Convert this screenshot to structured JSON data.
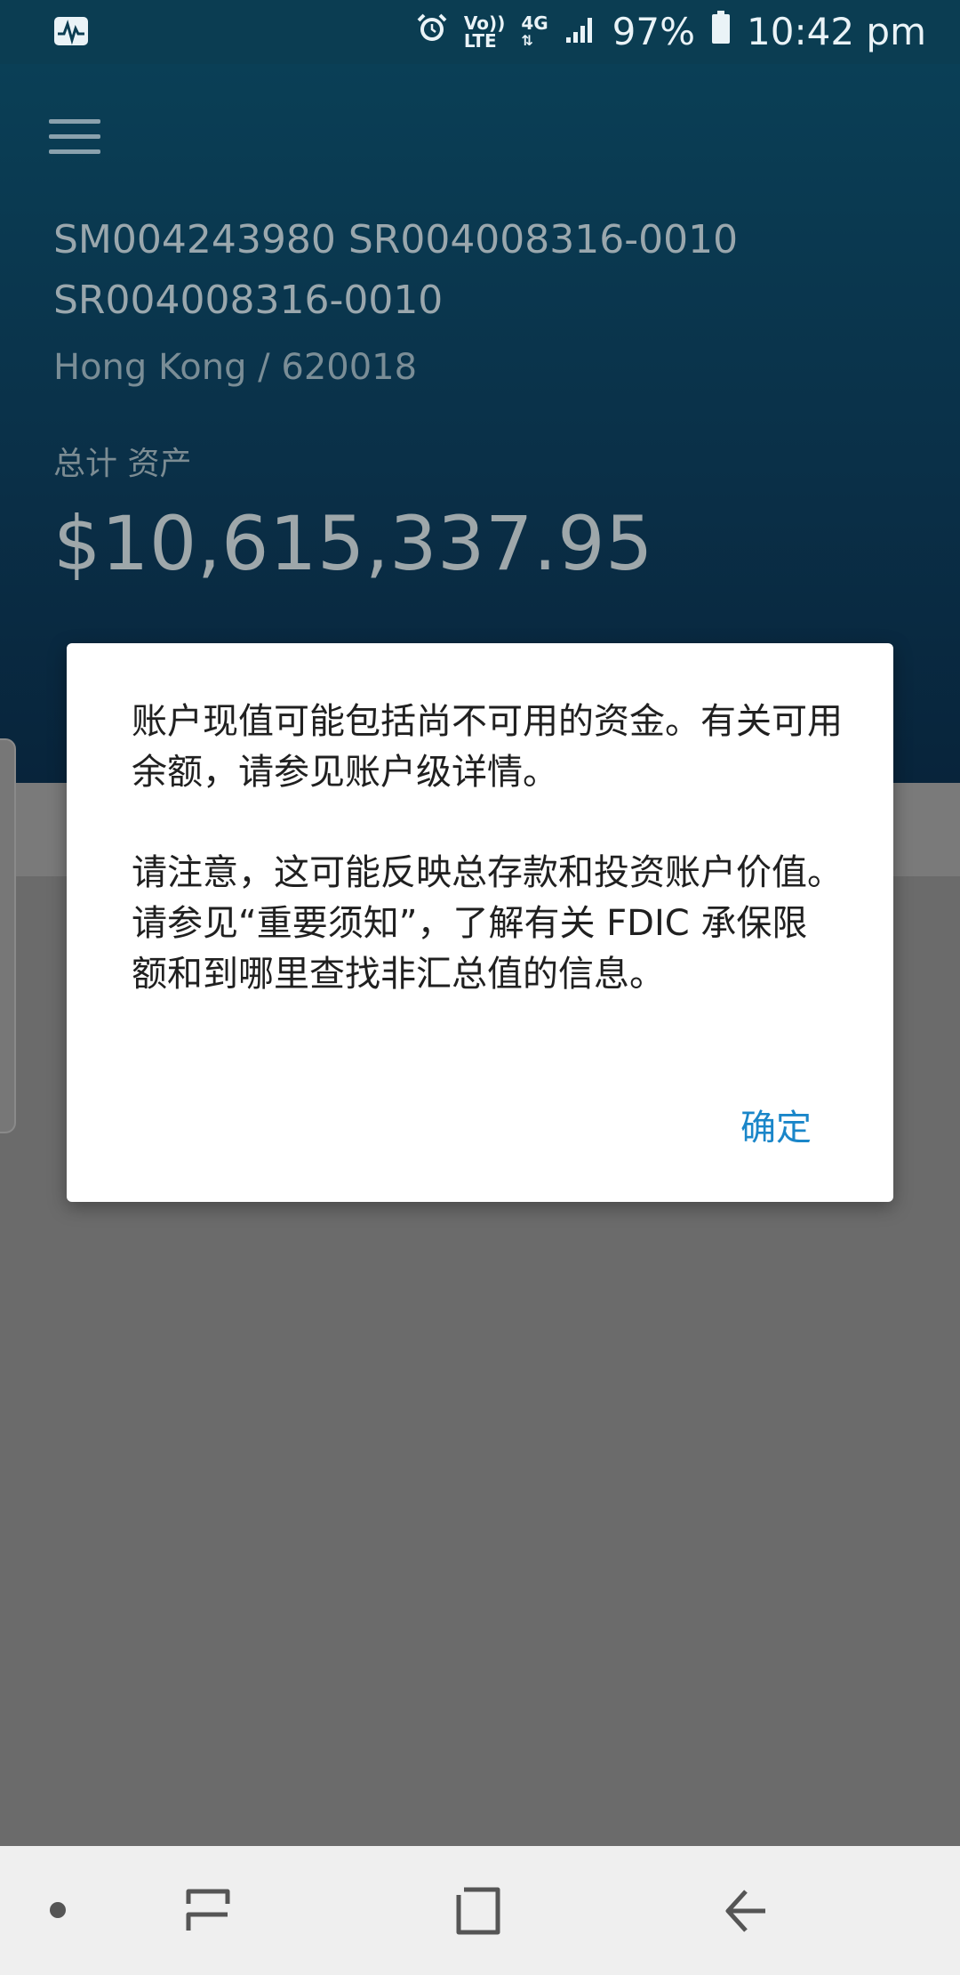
{
  "status_bar": {
    "battery": "97%",
    "time": "10:42 pm",
    "volte_top": "Vo))",
    "volte_bottom": "LTE",
    "network": "4G",
    "icons": [
      "activity-icon",
      "alarm-icon",
      "signal-icon",
      "battery-icon"
    ]
  },
  "header": {
    "account_line1": "SM004243980 SR004008316-0010",
    "account_line2": "SR004008316-0010",
    "location": "Hong Kong / 620018",
    "total_label": "总计 资产",
    "total_value": "$10,615,337.95"
  },
  "dialog": {
    "paragraph1": "账户现值可能包括尚不可用的资金。有关可用余额，请参见账户级详情。",
    "paragraph2": "请注意，这可能反映总存款和投资账户价值。 请参见“重要须知”，了解有关 FDIC 承保限额和到哪里查找非汇总值的信息。",
    "ok_label": "确定"
  },
  "colors": {
    "status_bar": "#0b3d52",
    "header_top": "#0a3f56",
    "header_bottom": "#08243b",
    "overlay": "#6b6b6b",
    "accent": "#1a86c9"
  },
  "navbar": {
    "icons": [
      "dot-icon",
      "recent-apps-icon",
      "home-icon",
      "back-icon"
    ]
  }
}
